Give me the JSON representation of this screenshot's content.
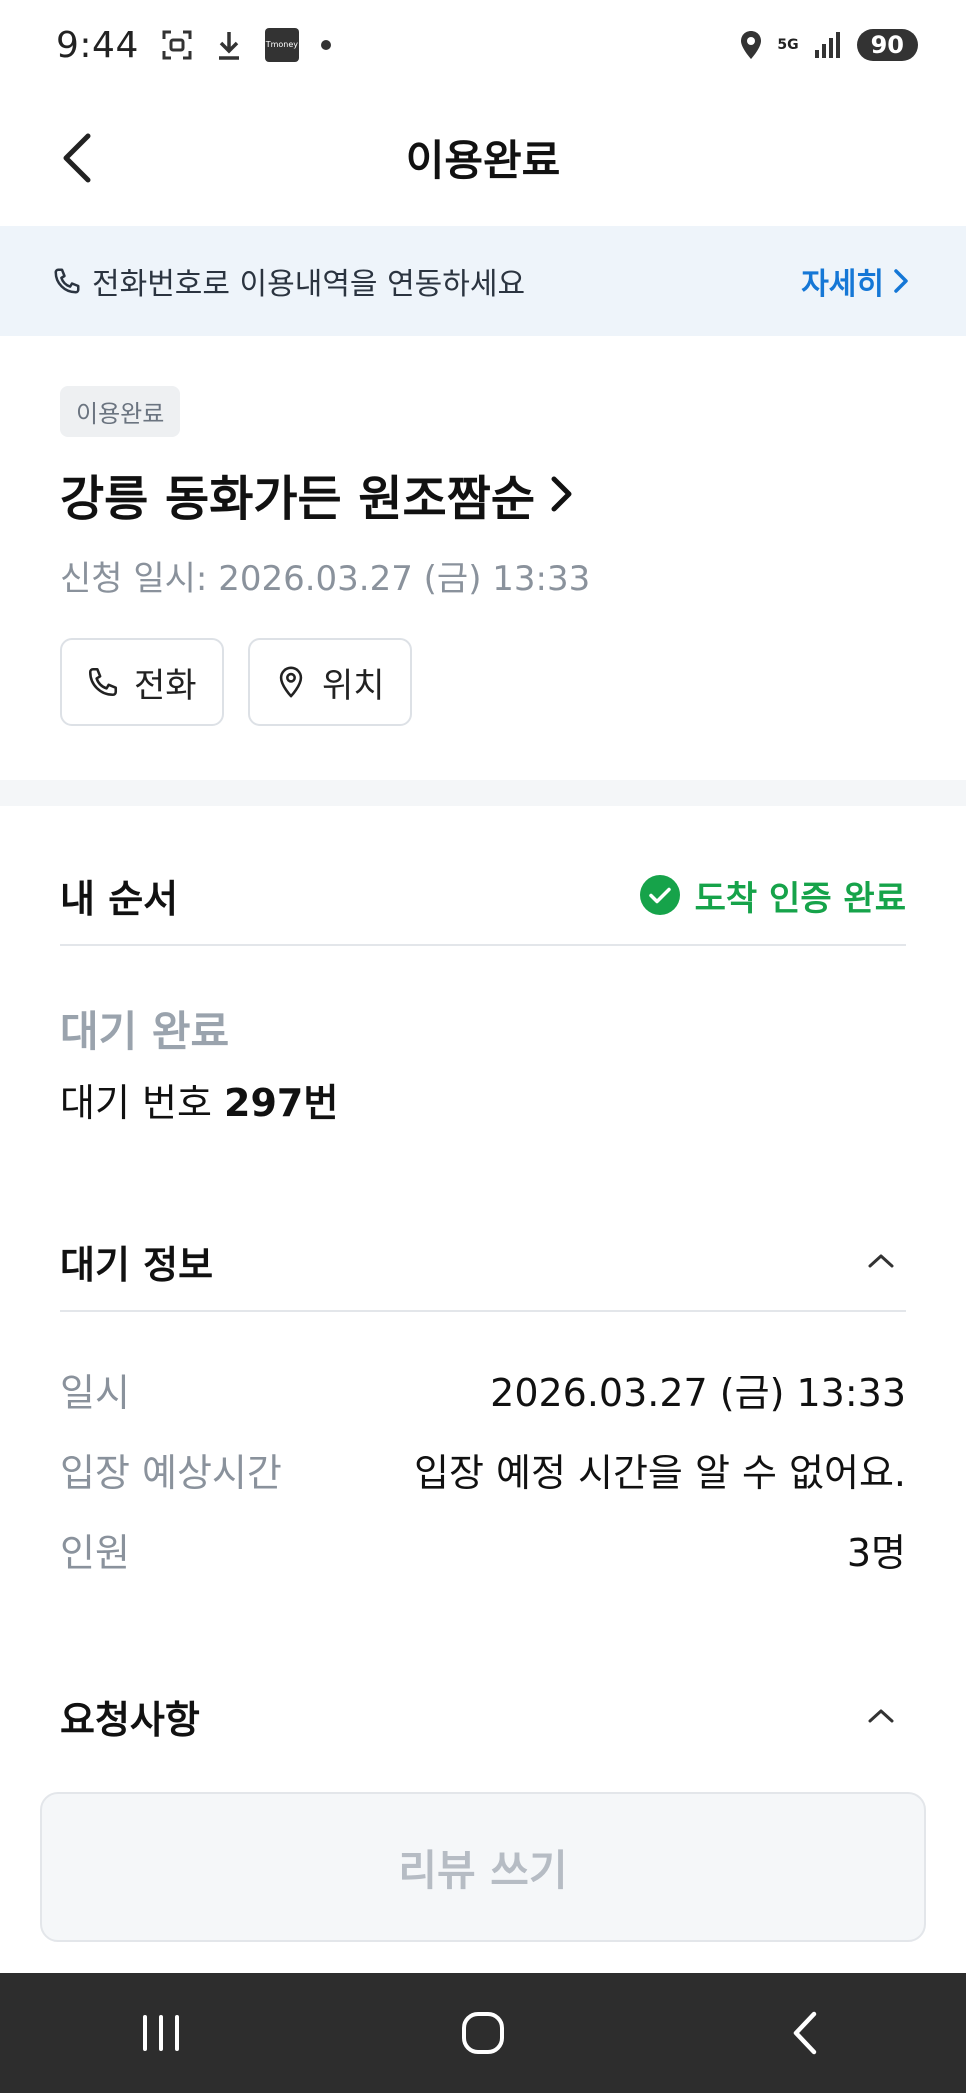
{
  "status_bar": {
    "time": "9:44",
    "tmoney_text": "Tmoney",
    "network_label": "5G",
    "battery": "90"
  },
  "header": {
    "title": "이용완료"
  },
  "banner": {
    "text": "전화번호로 이용내역을 연동하세요",
    "link_label": "자세히"
  },
  "store": {
    "status_chip": "이용완료",
    "name": "강릉 동화가든 원조짬순",
    "apply_date": "신청 일시: 2026.03.27 (금) 13:33",
    "buttons": {
      "call": "전화",
      "location": "위치"
    }
  },
  "my_order": {
    "title": "내 순서",
    "verification": "도착 인증 완료",
    "wait_status": "대기 완료",
    "wait_number_label": "대기 번호",
    "wait_number_value": "297번"
  },
  "wait_info": {
    "title": "대기 정보",
    "rows": [
      {
        "label": "일시",
        "value": "2026.03.27 (금) 13:33"
      },
      {
        "label": "입장 예상시간",
        "value": "입장 예정 시간을 알 수 없어요."
      },
      {
        "label": "인원",
        "value": "3명"
      }
    ]
  },
  "requests": {
    "title": "요청사항"
  },
  "review_button": {
    "label": "리뷰 쓰기"
  },
  "colors": {
    "accent_blue": "#1577d6",
    "success_green": "#16a34a",
    "banner_bg": "#eef4fa",
    "nav_bg": "#2d2d2d"
  }
}
